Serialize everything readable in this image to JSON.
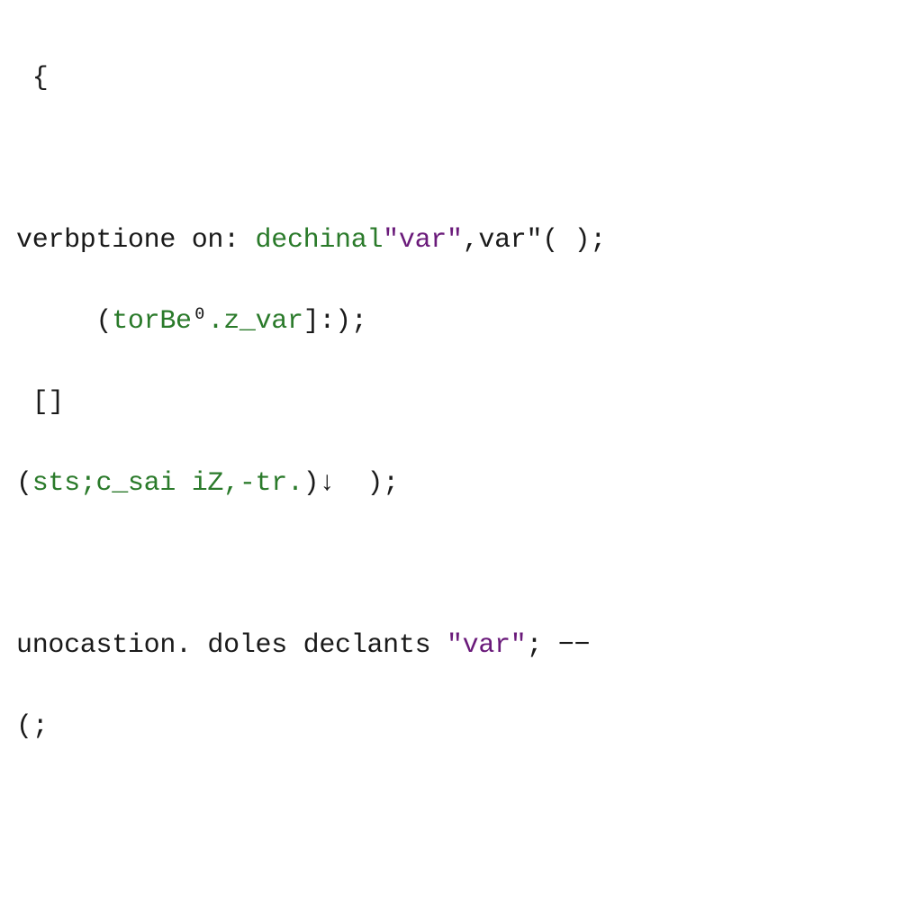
{
  "code": {
    "line1": " {",
    "line2": {
      "part1": "verbptione",
      "part2": " on: ",
      "part3": "dechinal",
      "part4": "\"var\"",
      "part5": ",var\"",
      "part6": "( );"
    },
    "line3": {
      "indent": "     (",
      "part1": "torBe",
      "part2": "⁰",
      "part3": ".z_var",
      "part4": "]:);"
    },
    "line4": " []",
    "line5": {
      "part1": "(",
      "part2": "sts",
      "part3": ";c_sai iZ,-tr.",
      "part4": ")",
      "part5": "↓  );"
    },
    "line6": {
      "part1": "unocastion. doles declants ",
      "part2": "\"var\"",
      "part3": "; −−"
    },
    "line7": "(;"
  }
}
